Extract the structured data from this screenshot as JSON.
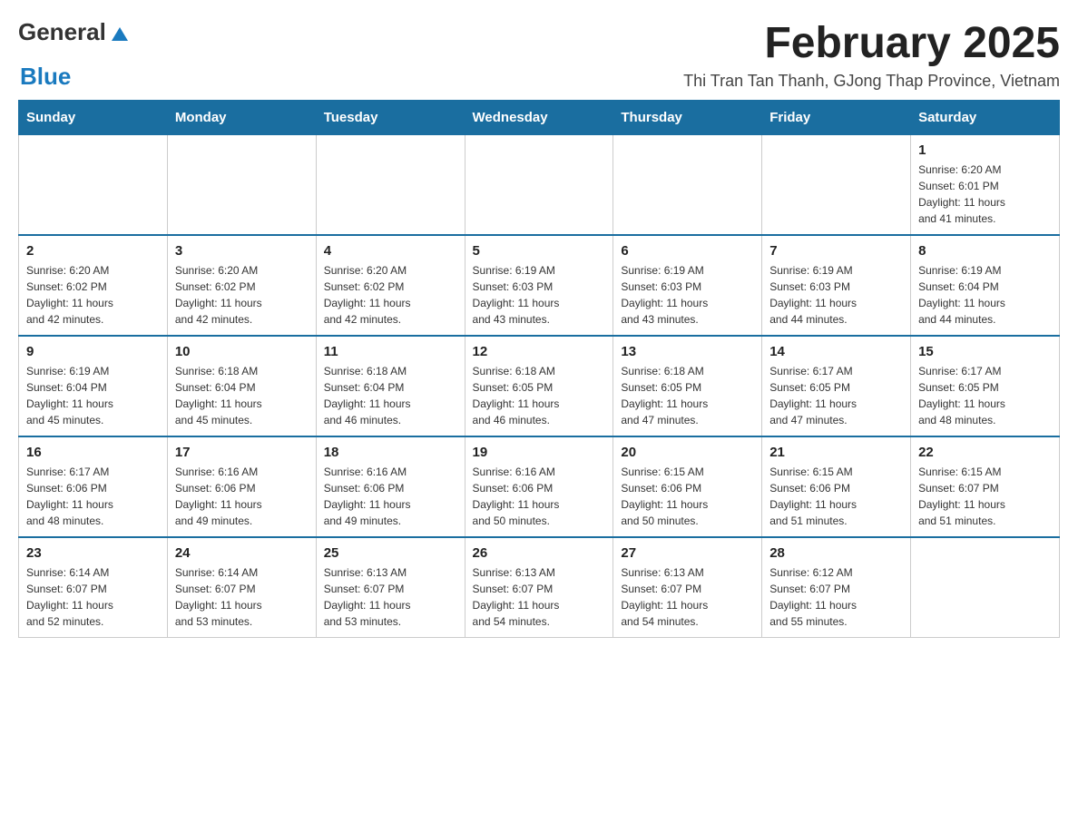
{
  "header": {
    "logo_general": "General",
    "logo_blue": "Blue",
    "month_title": "February 2025",
    "location": "Thi Tran Tan Thanh, GJong Thap Province, Vietnam"
  },
  "days_of_week": [
    "Sunday",
    "Monday",
    "Tuesday",
    "Wednesday",
    "Thursday",
    "Friday",
    "Saturday"
  ],
  "weeks": [
    {
      "days": [
        {
          "number": "",
          "info": ""
        },
        {
          "number": "",
          "info": ""
        },
        {
          "number": "",
          "info": ""
        },
        {
          "number": "",
          "info": ""
        },
        {
          "number": "",
          "info": ""
        },
        {
          "number": "",
          "info": ""
        },
        {
          "number": "1",
          "info": "Sunrise: 6:20 AM\nSunset: 6:01 PM\nDaylight: 11 hours\nand 41 minutes."
        }
      ]
    },
    {
      "days": [
        {
          "number": "2",
          "info": "Sunrise: 6:20 AM\nSunset: 6:02 PM\nDaylight: 11 hours\nand 42 minutes."
        },
        {
          "number": "3",
          "info": "Sunrise: 6:20 AM\nSunset: 6:02 PM\nDaylight: 11 hours\nand 42 minutes."
        },
        {
          "number": "4",
          "info": "Sunrise: 6:20 AM\nSunset: 6:02 PM\nDaylight: 11 hours\nand 42 minutes."
        },
        {
          "number": "5",
          "info": "Sunrise: 6:19 AM\nSunset: 6:03 PM\nDaylight: 11 hours\nand 43 minutes."
        },
        {
          "number": "6",
          "info": "Sunrise: 6:19 AM\nSunset: 6:03 PM\nDaylight: 11 hours\nand 43 minutes."
        },
        {
          "number": "7",
          "info": "Sunrise: 6:19 AM\nSunset: 6:03 PM\nDaylight: 11 hours\nand 44 minutes."
        },
        {
          "number": "8",
          "info": "Sunrise: 6:19 AM\nSunset: 6:04 PM\nDaylight: 11 hours\nand 44 minutes."
        }
      ]
    },
    {
      "days": [
        {
          "number": "9",
          "info": "Sunrise: 6:19 AM\nSunset: 6:04 PM\nDaylight: 11 hours\nand 45 minutes."
        },
        {
          "number": "10",
          "info": "Sunrise: 6:18 AM\nSunset: 6:04 PM\nDaylight: 11 hours\nand 45 minutes."
        },
        {
          "number": "11",
          "info": "Sunrise: 6:18 AM\nSunset: 6:04 PM\nDaylight: 11 hours\nand 46 minutes."
        },
        {
          "number": "12",
          "info": "Sunrise: 6:18 AM\nSunset: 6:05 PM\nDaylight: 11 hours\nand 46 minutes."
        },
        {
          "number": "13",
          "info": "Sunrise: 6:18 AM\nSunset: 6:05 PM\nDaylight: 11 hours\nand 47 minutes."
        },
        {
          "number": "14",
          "info": "Sunrise: 6:17 AM\nSunset: 6:05 PM\nDaylight: 11 hours\nand 47 minutes."
        },
        {
          "number": "15",
          "info": "Sunrise: 6:17 AM\nSunset: 6:05 PM\nDaylight: 11 hours\nand 48 minutes."
        }
      ]
    },
    {
      "days": [
        {
          "number": "16",
          "info": "Sunrise: 6:17 AM\nSunset: 6:06 PM\nDaylight: 11 hours\nand 48 minutes."
        },
        {
          "number": "17",
          "info": "Sunrise: 6:16 AM\nSunset: 6:06 PM\nDaylight: 11 hours\nand 49 minutes."
        },
        {
          "number": "18",
          "info": "Sunrise: 6:16 AM\nSunset: 6:06 PM\nDaylight: 11 hours\nand 49 minutes."
        },
        {
          "number": "19",
          "info": "Sunrise: 6:16 AM\nSunset: 6:06 PM\nDaylight: 11 hours\nand 50 minutes."
        },
        {
          "number": "20",
          "info": "Sunrise: 6:15 AM\nSunset: 6:06 PM\nDaylight: 11 hours\nand 50 minutes."
        },
        {
          "number": "21",
          "info": "Sunrise: 6:15 AM\nSunset: 6:06 PM\nDaylight: 11 hours\nand 51 minutes."
        },
        {
          "number": "22",
          "info": "Sunrise: 6:15 AM\nSunset: 6:07 PM\nDaylight: 11 hours\nand 51 minutes."
        }
      ]
    },
    {
      "days": [
        {
          "number": "23",
          "info": "Sunrise: 6:14 AM\nSunset: 6:07 PM\nDaylight: 11 hours\nand 52 minutes."
        },
        {
          "number": "24",
          "info": "Sunrise: 6:14 AM\nSunset: 6:07 PM\nDaylight: 11 hours\nand 53 minutes."
        },
        {
          "number": "25",
          "info": "Sunrise: 6:13 AM\nSunset: 6:07 PM\nDaylight: 11 hours\nand 53 minutes."
        },
        {
          "number": "26",
          "info": "Sunrise: 6:13 AM\nSunset: 6:07 PM\nDaylight: 11 hours\nand 54 minutes."
        },
        {
          "number": "27",
          "info": "Sunrise: 6:13 AM\nSunset: 6:07 PM\nDaylight: 11 hours\nand 54 minutes."
        },
        {
          "number": "28",
          "info": "Sunrise: 6:12 AM\nSunset: 6:07 PM\nDaylight: 11 hours\nand 55 minutes."
        },
        {
          "number": "",
          "info": ""
        }
      ]
    }
  ]
}
